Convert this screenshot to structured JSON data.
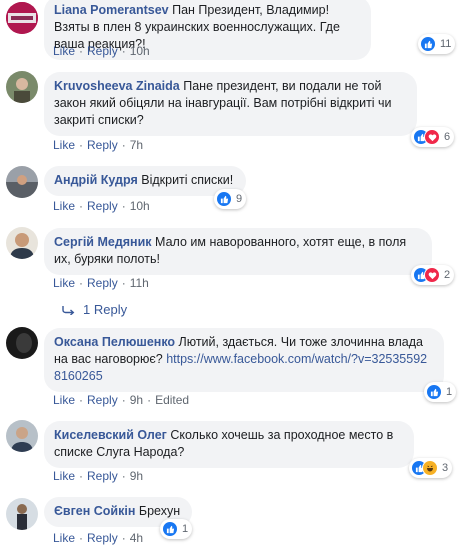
{
  "comments": [
    {
      "author": "Liana Pomerantsev",
      "text": "Пан Президент, Владимир! Взяты в плен 8 украинских военнослужащих. Где ваша реакция?!",
      "actions": [
        "Like",
        "Reply",
        "10h"
      ],
      "reaction_count": "11",
      "reactions": [
        "like"
      ]
    },
    {
      "author": "Kruvosheeva Zinaida",
      "text": "Пане президент, ви подали не той закон який обіцяли на інавгурації. Вам потрібні відкриті чи закриті списки?",
      "actions": [
        "Like",
        "Reply",
        "7h"
      ],
      "reaction_count": "6",
      "reactions": [
        "like",
        "love"
      ]
    },
    {
      "author": "Андрій Кудря",
      "text": "Відкриті списки!",
      "actions": [
        "Like",
        "Reply",
        "10h"
      ],
      "reaction_count": "9",
      "reactions": [
        "like"
      ]
    },
    {
      "author": "Сергій Медяник",
      "text": "Мало им наворованного, хотят еще, в поля их, буряки полоть!",
      "actions": [
        "Like",
        "Reply",
        "11h"
      ],
      "reaction_count": "2",
      "reactions": [
        "like",
        "love"
      ],
      "replies_label": "1 Reply"
    },
    {
      "author": "Оксана Пелюшенко",
      "text_before_link": "Лютий, здається. Чи тоже злочинна влада на вас наговорює? ",
      "link": "https://www.facebook.com/watch/?v=325355928160265",
      "actions": [
        "Like",
        "Reply",
        "9h",
        "Edited"
      ],
      "reaction_count": "1",
      "reactions": [
        "like"
      ]
    },
    {
      "author": "Киселевский Олег",
      "text": "Сколько хочешь за проходное место в списке Слуга Народа?",
      "actions": [
        "Like",
        "Reply",
        "9h"
      ],
      "reaction_count": "3",
      "reactions": [
        "like",
        "haha"
      ]
    },
    {
      "author": "Євген Сойкін",
      "text": "Брехун",
      "actions": [
        "Like",
        "Reply",
        "4h"
      ],
      "reaction_count": "1",
      "reactions": [
        "like"
      ]
    }
  ],
  "colors": {
    "name": "#385898",
    "bubble": "#f2f3f5",
    "like": "#1877f2",
    "love": "#f0284a",
    "haha": "#f7b125"
  }
}
